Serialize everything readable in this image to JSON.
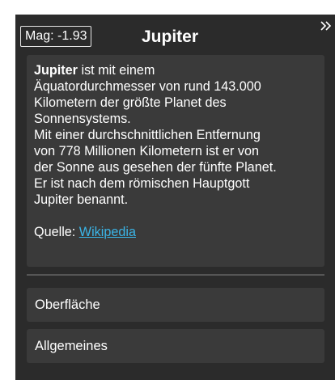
{
  "header": {
    "magnitude": "Mag: -1.93",
    "title": "Jupiter",
    "collapse_icon": "double-chevron-right-icon"
  },
  "description": {
    "bold_name": "Jupiter",
    "text": " ist mit einem Äquatordurchmesser von rund 143.000 Kilometern der größte Planet des Sonnensystems. Mit einer durchschnittlichen Entfernung von 778 Millionen Kilometern ist er von der Sonne aus gesehen der fünfte Planet. Er ist nach dem römischen Hauptgott Jupiter benannt.",
    "lines": [
      "Äquatordurchmesser von rund 143.000",
      "Kilometern der größte Planet des",
      "Sonnensystems.",
      "Mit einer durchschnittlichen Entfernung",
      "von 778 Millionen Kilometern ist er von",
      "der Sonne aus gesehen der fünfte Planet.",
      "Er ist nach dem römischen Hauptgott",
      "Jupiter benannt."
    ],
    "first_line_rest": " ist mit einem",
    "source_label": "Quelle: ",
    "source_link": "Wikipedia"
  },
  "sections": [
    {
      "label": "Oberfläche"
    },
    {
      "label": "Allgemeines"
    }
  ],
  "colors": {
    "panel_bg": "#2b2b2b",
    "card_bg": "#3a3a3a",
    "link": "#3ab4e6",
    "text": "#ffffff"
  }
}
